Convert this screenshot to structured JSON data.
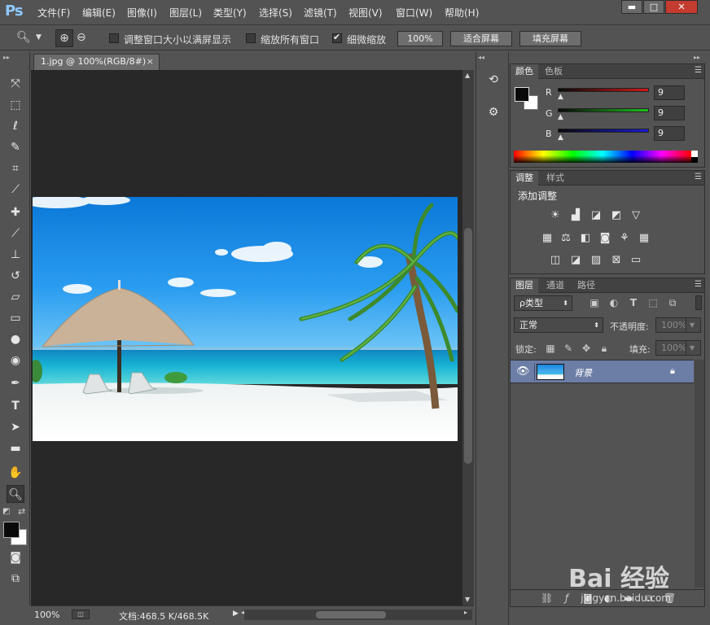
{
  "app": {
    "logo": "Ps"
  },
  "menu": [
    "文件(F)",
    "编辑(E)",
    "图像(I)",
    "图层(L)",
    "类型(Y)",
    "选择(S)",
    "滤镜(T)",
    "视图(V)",
    "窗口(W)",
    "帮助(H)"
  ],
  "window_controls": {
    "minimize": "▬",
    "maximize": "□",
    "close": "✕"
  },
  "options": {
    "resize_windows": {
      "label": "调整窗口大小以满屏显示",
      "checked": false
    },
    "zoom_all": {
      "label": "缩放所有窗口",
      "checked": false
    },
    "scrubby_zoom": {
      "label": "细微缩放",
      "checked": true
    },
    "btn_100": "100%",
    "btn_fit": "适合屏幕",
    "btn_fill": "填充屏幕"
  },
  "document": {
    "tab_title": "1.jpg @ 100%(RGB/8#)",
    "close_glyph": "×",
    "zoom": "100%",
    "doc_size": "文档:468.5 K/468.5K"
  },
  "color_panel": {
    "tabs": [
      "颜色",
      "色板"
    ],
    "channels": [
      {
        "label": "R",
        "value": "9"
      },
      {
        "label": "G",
        "value": "9"
      },
      {
        "label": "B",
        "value": "9"
      }
    ],
    "colors": {
      "red": "#d21a1a",
      "green": "#1ec01e",
      "blue": "#1a1ad6",
      "foreground": "#090909",
      "background": "#ffffff"
    }
  },
  "adjust_panel": {
    "tabs": [
      "调整",
      "样式"
    ],
    "title": "添加调整"
  },
  "layers_panel": {
    "tabs": [
      "图层",
      "通道",
      "路径"
    ],
    "filter_label": "ρ类型",
    "blend_mode": "正常",
    "opacity_label": "不透明度:",
    "opacity_value": "100%",
    "lock_label": "锁定:",
    "fill_label": "填充:",
    "fill_value": "100%",
    "layers": [
      {
        "name": "背景",
        "visible": true,
        "locked": true
      }
    ]
  },
  "watermark": {
    "logo": "Bai 经验",
    "url": "jingyan.baidu.com"
  }
}
